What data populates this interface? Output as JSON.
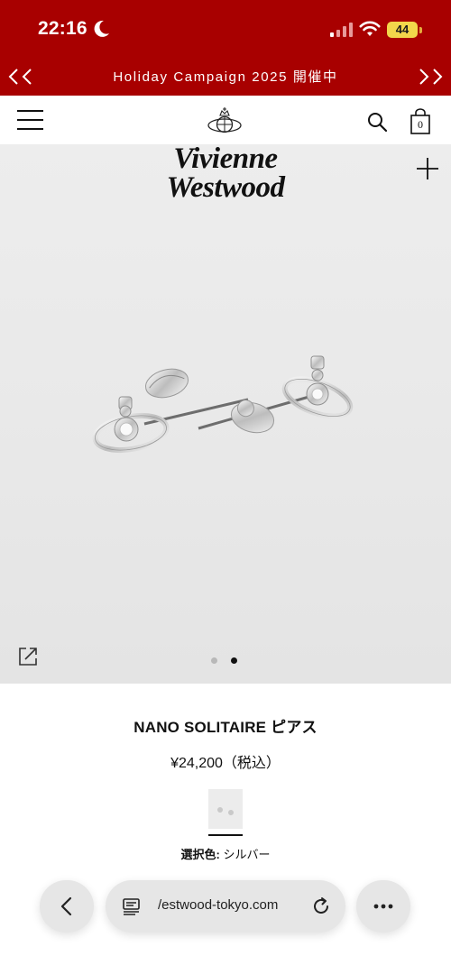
{
  "status_bar": {
    "time": "22:16",
    "battery_level": "44",
    "icons": [
      "moon-icon",
      "signal-icon",
      "wifi-icon",
      "battery-icon"
    ],
    "accent_color": "#a80000",
    "battery_color": "#f2d64b"
  },
  "banner": {
    "text": "Holiday Campaign 2025 開催中",
    "prev_icon": "double-chevron-left-icon",
    "next_icon": "double-chevron-right-icon"
  },
  "header": {
    "icons": [
      "hamburger-menu-icon",
      "orb-logo-icon",
      "search-icon",
      "shopping-bag-icon"
    ],
    "cart_count": "0"
  },
  "hero": {
    "brand_wordmark": "Vivienne Westwood",
    "image_subject": "silver earrings photo",
    "carousel": {
      "slides": 2,
      "active": 2
    },
    "icons": [
      "plus-icon",
      "share-icon"
    ]
  },
  "product": {
    "title": "NANO SOLITAIRE ピアス",
    "price": "¥24,200（税込）",
    "selected_color_label": "選択色:",
    "selected_color_value": "シルバー"
  },
  "browser_bar": {
    "url": "/estwood-tokyo.com",
    "icons": [
      "back-chevron-icon",
      "reader-mode-icon",
      "reload-icon",
      "more-ellipsis-icon"
    ]
  }
}
